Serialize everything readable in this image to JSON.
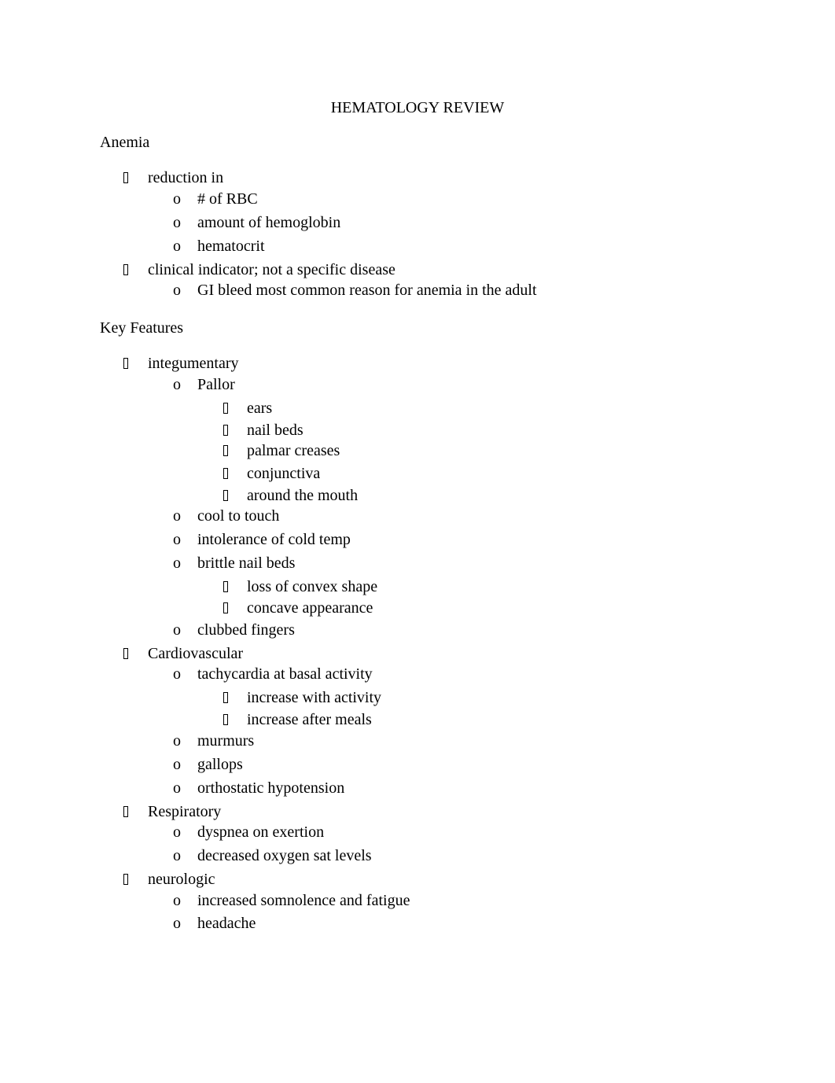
{
  "document": {
    "title": "HEMATOLOGY REVIEW",
    "bullet_glyphs": {
      "level1": "missing-glyph-box",
      "level2": "o",
      "level3": "missing-glyph-box"
    },
    "sections": [
      {
        "heading": "Anemia",
        "items": [
          {
            "level": 1,
            "text": "reduction in"
          },
          {
            "level": 2,
            "text": "# of RBC"
          },
          {
            "level": 2,
            "text": "amount of hemoglobin"
          },
          {
            "level": 2,
            "text": "hematocrit"
          },
          {
            "level": 1,
            "text": "clinical indicator; not a specific disease"
          },
          {
            "level": 2,
            "text": "GI bleed most common reason for anemia in the adult"
          }
        ]
      },
      {
        "heading": "Key Features",
        "items": [
          {
            "level": 1,
            "text": "integumentary"
          },
          {
            "level": 2,
            "text": "Pallor"
          },
          {
            "level": 3,
            "text": "ears"
          },
          {
            "level": 3,
            "text": "nail beds"
          },
          {
            "level": 3,
            "text": "palmar creases"
          },
          {
            "level": 3,
            "text": "conjunctiva"
          },
          {
            "level": 3,
            "text": "around the mouth"
          },
          {
            "level": 2,
            "text": "cool to touch"
          },
          {
            "level": 2,
            "text": "intolerance of cold temp"
          },
          {
            "level": 2,
            "text": "brittle nail beds"
          },
          {
            "level": 3,
            "text": "loss of convex shape"
          },
          {
            "level": 3,
            "text": "concave appearance"
          },
          {
            "level": 2,
            "text": "clubbed fingers"
          },
          {
            "level": 1,
            "text": "Cardiovascular"
          },
          {
            "level": 2,
            "text": "tachycardia at basal activity"
          },
          {
            "level": 3,
            "text": "increase with activity"
          },
          {
            "level": 3,
            "text": "increase after meals"
          },
          {
            "level": 2,
            "text": "murmurs"
          },
          {
            "level": 2,
            "text": "gallops"
          },
          {
            "level": 2,
            "text": "orthostatic hypotension"
          },
          {
            "level": 1,
            "text": "Respiratory"
          },
          {
            "level": 2,
            "text": "dyspnea on exertion"
          },
          {
            "level": 2,
            "text": "decreased oxygen sat levels"
          },
          {
            "level": 1,
            "text": "neurologic"
          },
          {
            "level": 2,
            "text": "increased somnolence and fatigue"
          },
          {
            "level": 2,
            "text": "headache"
          }
        ]
      }
    ]
  }
}
